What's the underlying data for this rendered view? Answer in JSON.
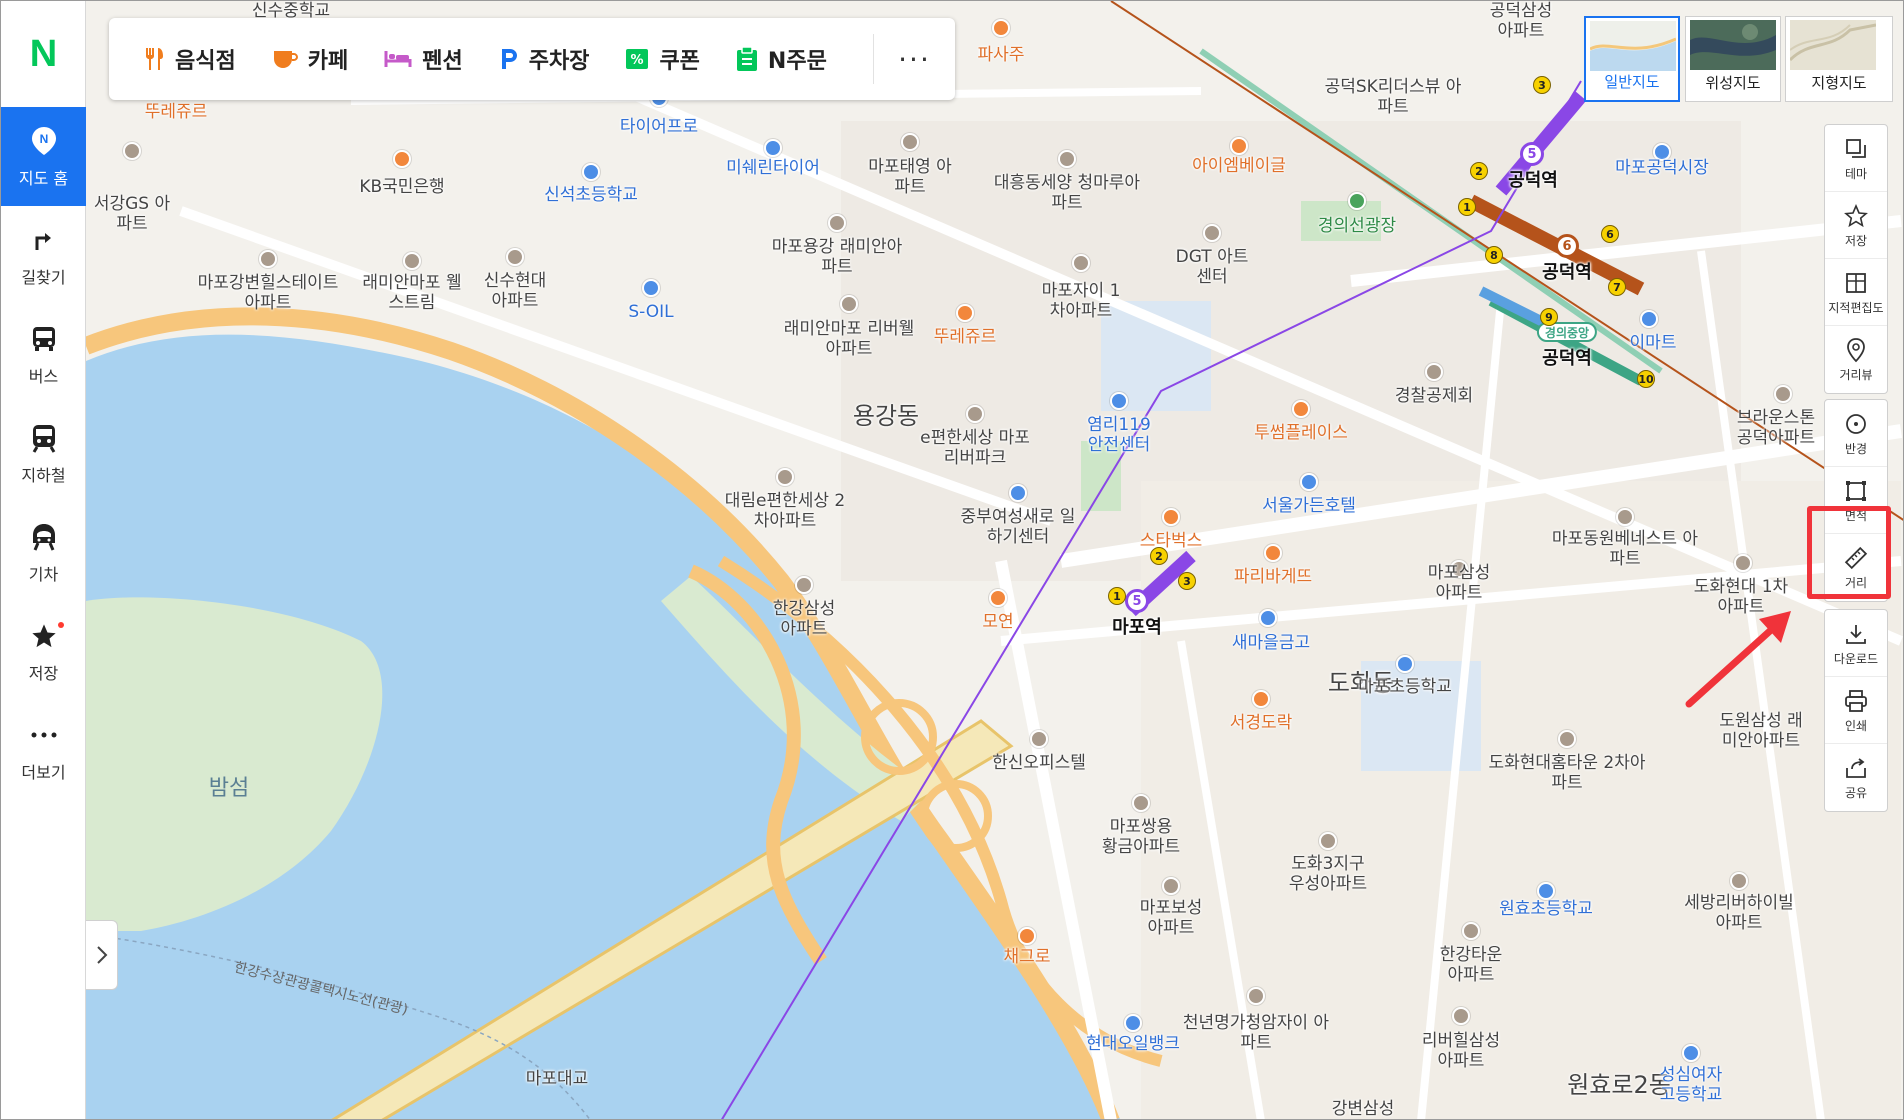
{
  "colors": {
    "accent": "#1a73f0",
    "brand_green": "#03c75a",
    "highlight_red": "#f0333a",
    "line5": "#8a47e6",
    "line6": "#b5531b",
    "gyeongui": "#3da585",
    "river": "#a9d2f0"
  },
  "sidebar": {
    "logo": "N",
    "items": [
      {
        "label": "지도 홈",
        "icon": "map-pin-icon",
        "active": true
      },
      {
        "label": "길찾기",
        "icon": "directions-arrow-icon"
      },
      {
        "label": "버스",
        "icon": "bus-icon"
      },
      {
        "label": "지하철",
        "icon": "subway-icon"
      },
      {
        "label": "기차",
        "icon": "train-icon"
      },
      {
        "label": "저장",
        "icon": "star-icon",
        "has_dot": true
      },
      {
        "label": "더보기",
        "icon": "more-dots-icon"
      }
    ]
  },
  "categories": [
    {
      "label": "음식점",
      "icon": "restaurant-icon",
      "color": "#f07d1e"
    },
    {
      "label": "카페",
      "icon": "cafe-icon",
      "color": "#f07d1e"
    },
    {
      "label": "펜션",
      "icon": "bed-icon",
      "color": "#c55ac9"
    },
    {
      "label": "주차장",
      "icon": "parking-icon",
      "color": "#1a73f0"
    },
    {
      "label": "쿠폰",
      "icon": "coupon-icon",
      "color": "#03c75a"
    },
    {
      "label": "N주문",
      "icon": "order-icon",
      "color": "#03c75a"
    }
  ],
  "more_label": "···",
  "map_types": [
    {
      "label": "일반지도",
      "selected": true
    },
    {
      "label": "위성지도",
      "selected": false
    },
    {
      "label": "지형지도",
      "selected": false
    }
  ],
  "tools_group1": [
    {
      "label": "테마",
      "icon": "layers-icon"
    },
    {
      "label": "저장",
      "icon": "star-outline-icon"
    },
    {
      "label": "지적편집도",
      "icon": "cadastral-icon"
    },
    {
      "label": "거리뷰",
      "icon": "streetview-icon"
    }
  ],
  "tools_group2": [
    {
      "label": "반경",
      "icon": "radius-icon"
    },
    {
      "label": "면적",
      "icon": "area-icon"
    },
    {
      "label": "거리",
      "icon": "ruler-icon"
    }
  ],
  "tools_group3": [
    {
      "label": "다운로드",
      "icon": "download-icon"
    },
    {
      "label": "인쇄",
      "icon": "print-icon"
    },
    {
      "label": "공유",
      "icon": "share-icon"
    }
  ],
  "map_labels": {
    "areas": [
      "용강동",
      "도화동",
      "원효로2동"
    ],
    "water": [
      "밤섬"
    ],
    "route_label": "한강수상관광콜택시노선(관광)",
    "bridge": "마포대교",
    "stations": [
      "공덕역",
      "공덕역",
      "공덕역",
      "마포역"
    ],
    "line_badges": [
      "5",
      "6",
      "5",
      "경의중앙"
    ],
    "pois": [
      "신수중학교",
      "뚜레쥬르",
      "서강GS 아파트",
      "타이어프로",
      "미쉐린타이어",
      "KB국민은행",
      "신석초등학교",
      "마포태영 아파트",
      "대흥동세양 청마루아파트",
      "마포용강 래미안아파트",
      "마포강변힐스테이트 아파트",
      "래미안마포 웰스트림",
      "신수현대 아파트",
      "S-OIL",
      "래미안마포 리버웰아파트",
      "뚜레쥬르",
      "DGT 아트센터",
      "마포자이 1차아파트",
      "공덕SK리더스뷰 아파트",
      "아이엠베이글",
      "경의선광장",
      "마포공덕시장",
      "이마트",
      "경찰공제회",
      "투썸플레이스",
      "e편한세상 마포리버파크",
      "염리119 안전센터",
      "대림e편한세상 2차아파트",
      "중부여성새로 일하기센터",
      "서울가든호텔",
      "스타벅스",
      "파리바게뜨",
      "모연",
      "한강삼성 아파트",
      "새마을금고",
      "마포동원베네스트 아파트",
      "마포삼성 아파트",
      "도화현대 1차아파트",
      "마포초등학교",
      "서경도락",
      "한신오피스텔",
      "도화현대홈타운 2차아파트",
      "마포쌍용 황금아파트",
      "도화3지구 우성아파트",
      "마포보성 아파트",
      "원효초등학교",
      "세방리버하이빌 아파트",
      "채그로",
      "한강타운 아파트",
      "현대오일뱅크",
      "천년명가청암자이 아파트",
      "리버힐삼성 아파트",
      "성심여자 고등학교",
      "강변삼성",
      "파사주",
      "브라운스톤 공덕아파트",
      "도원삼성 래미안아파트",
      "공덕삼성 아파트"
    ]
  },
  "collapse_icon": "chevron-right-icon"
}
